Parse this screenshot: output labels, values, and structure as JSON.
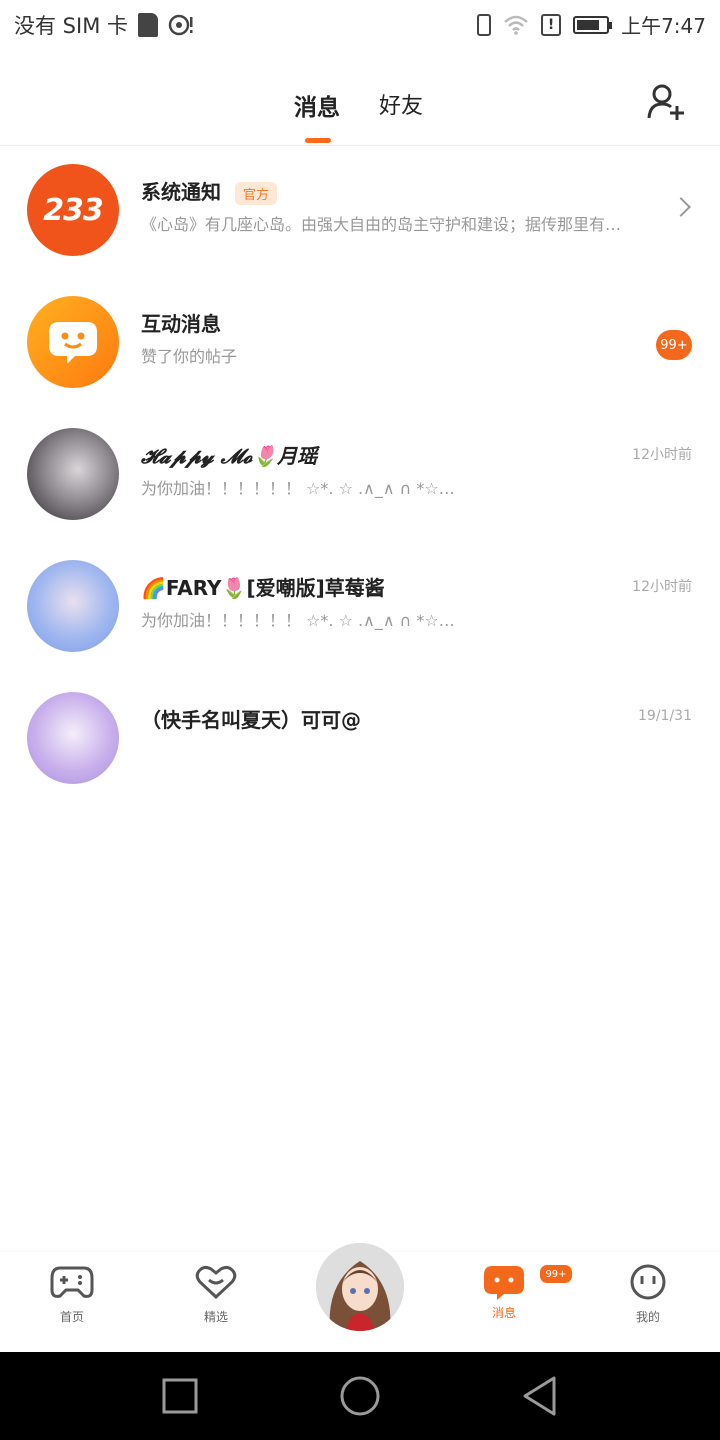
{
  "status_bar": {
    "carrier": "没有 SIM 卡",
    "time": "上午7:47",
    "battery_level": 0.8
  },
  "header": {
    "tabs": [
      {
        "label": "消息",
        "active": true
      },
      {
        "label": "好友",
        "active": false
      }
    ],
    "add_friend_icon": "add-user-icon"
  },
  "messages": [
    {
      "name": "系统通知",
      "badge": "官方",
      "preview": "《心岛》有几座心岛。由强大自由的岛主守护和建设；据传那里有…",
      "avatar_text": "233",
      "trailing": "chevron-right-icon"
    },
    {
      "name": "互动消息",
      "preview": "赞了你的帖子",
      "count": "99+"
    },
    {
      "name": "𝓗𝓪𝓹𝓹𝔂 𝓜𝓸🌷月瑶",
      "preview": "为你加油！！！！！！  ☆*.   ☆     .∧_∧  ∩  *☆…",
      "time": "12小时前"
    },
    {
      "name": "🌈FARY🌷[爱嘲版]草莓酱",
      "preview": "为你加油！！！！！！  ☆*.   ☆     .∧_∧  ∩  *☆…",
      "time": "12小时前"
    },
    {
      "name": "（快手名叫夏天）可可@",
      "preview": "",
      "time": "19/1/31"
    }
  ],
  "bottom_nav": [
    {
      "label": "首页",
      "icon": "gamepad-icon",
      "active": false
    },
    {
      "label": "精选",
      "icon": "heart-icon",
      "active": false
    },
    {
      "label": "消息",
      "icon": "chat-icon",
      "active": true,
      "badge": "99+"
    },
    {
      "label": "我的",
      "icon": "smiley-icon",
      "active": false
    }
  ],
  "colors": {
    "accent": "#f4681b",
    "official_badge_bg": "#fde8d6",
    "official_badge_text": "#f07a2a"
  }
}
